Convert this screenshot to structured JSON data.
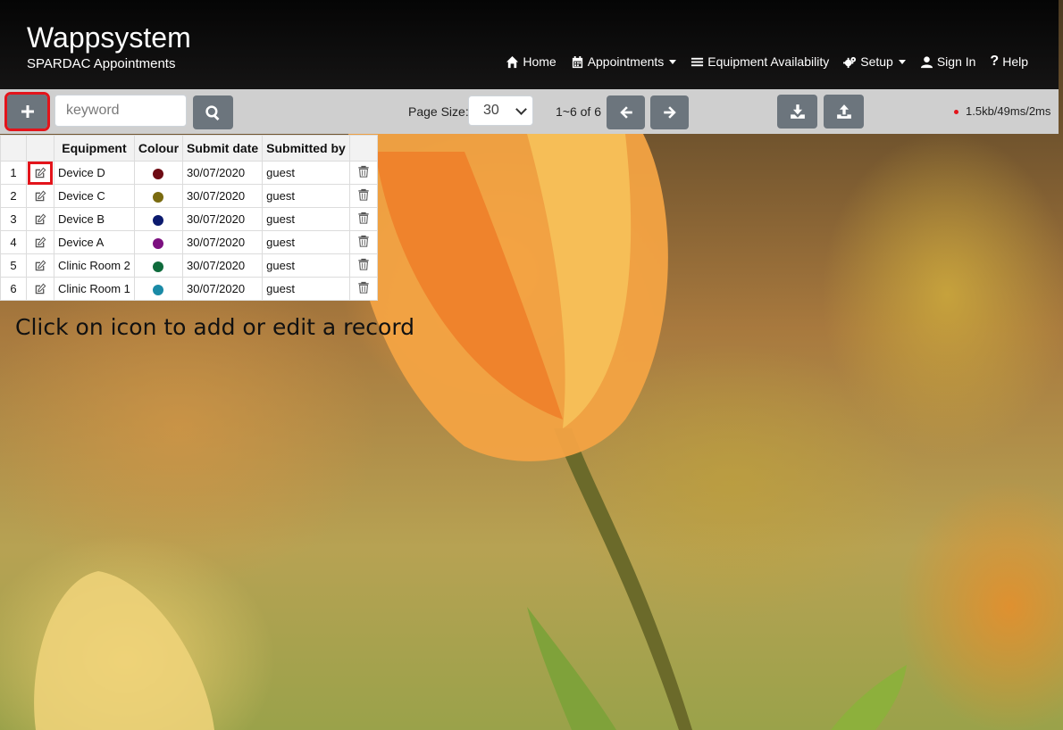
{
  "header": {
    "title": "Wappsystem",
    "subtitle": "SPARDAC Appointments"
  },
  "nav": [
    {
      "label": "Home",
      "icon": "home-icon"
    },
    {
      "label": "Appointments",
      "icon": "calendar-icon",
      "dropdown": true
    },
    {
      "label": "Equipment Availability",
      "icon": "list-icon"
    },
    {
      "label": "Setup",
      "icon": "cogs-icon",
      "dropdown": true
    },
    {
      "label": "Sign In",
      "icon": "user-icon"
    },
    {
      "label": "Help",
      "icon": "question-icon"
    }
  ],
  "toolbar": {
    "search_placeholder": "keyword",
    "page_size_label": "Page Size:",
    "page_size_value": "30",
    "range": "1~6 of 6",
    "stats": "1.5kb/49ms/2ms"
  },
  "table": {
    "headers": [
      "",
      "",
      "Equipment",
      "Colour",
      "Submit date",
      "Submitted by",
      ""
    ],
    "rows": [
      {
        "num": "1",
        "equipment": "Device D",
        "colour": "#6e0b14",
        "date": "30/07/2020",
        "by": "guest"
      },
      {
        "num": "2",
        "equipment": "Device C",
        "colour": "#7a6b10",
        "date": "30/07/2020",
        "by": "guest"
      },
      {
        "num": "3",
        "equipment": "Device B",
        "colour": "#0b1a6e",
        "date": "30/07/2020",
        "by": "guest"
      },
      {
        "num": "4",
        "equipment": "Device A",
        "colour": "#7c1080",
        "date": "30/07/2020",
        "by": "guest"
      },
      {
        "num": "5",
        "equipment": "Clinic Room 2",
        "colour": "#0f6b3c",
        "date": "30/07/2020",
        "by": "guest"
      },
      {
        "num": "6",
        "equipment": "Clinic Room 1",
        "colour": "#1a8aa6",
        "date": "30/07/2020",
        "by": "guest"
      }
    ]
  },
  "hint": "Click on icon to add or edit a record",
  "colors": {
    "highlight": "#e3141b",
    "button": "#6c757d",
    "toolbar_bg": "#cfcfcf"
  }
}
